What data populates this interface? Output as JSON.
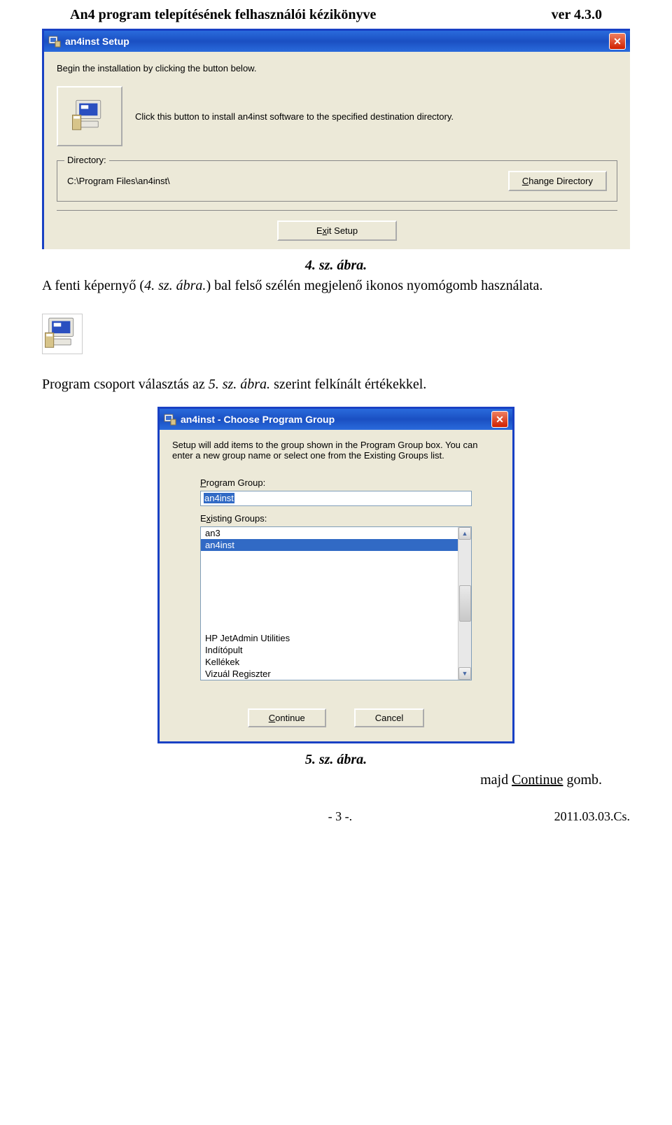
{
  "header": {
    "title": "An4 program telepítésének felhasználói kézikönyve",
    "version": "ver 4.3.0"
  },
  "fig1": {
    "window_title": "an4inst Setup",
    "instruction": "Begin the installation by clicking the button below.",
    "install_desc": "Click this button to install an4inst software to the specified destination directory.",
    "dir_legend": "Directory:",
    "dir_path": "C:\\Program Files\\an4inst\\",
    "change_dir_btn_pre": "",
    "change_dir_btn_u": "C",
    "change_dir_btn_post": "hange Directory",
    "exit_btn_pre": "E",
    "exit_btn_u": "x",
    "exit_btn_post": "it Setup",
    "caption": "4. sz. ábra."
  },
  "para1": {
    "pre": "A fenti képernyő (",
    "em": "4. sz. ábra.",
    "post": ") bal felső szélén megjelenő ikonos nyomógomb használata."
  },
  "para2": {
    "pre": "Program csoport választás az ",
    "em": "5. sz. ábra.",
    "post": " szerint felkínált értékekkel."
  },
  "fig2": {
    "window_title": "an4inst - Choose Program Group",
    "desc": "Setup will add items to the group shown in the Program Group box. You can enter a new group name or select one from the Existing Groups list.",
    "pg_label_u": "P",
    "pg_label_post": "rogram Group:",
    "pg_value": "an4inst",
    "eg_label_pre": "E",
    "eg_label_u": "x",
    "eg_label_post": "isting Groups:",
    "items_top": [
      "an3",
      "an4inst"
    ],
    "items_bottom": [
      "HP JetAdmin Utilities",
      "Indítópult",
      "Kellékek",
      "Vizuál Regiszter"
    ],
    "continue_u": "C",
    "continue_post": "ontinue",
    "cancel": "Cancel",
    "caption": "5. sz. ábra."
  },
  "para3": {
    "text_pre": "majd ",
    "continue_word": "Continue",
    "text_post": " gomb."
  },
  "footer": {
    "page": "- 3 -.",
    "date": "2011.03.03.Cs."
  }
}
